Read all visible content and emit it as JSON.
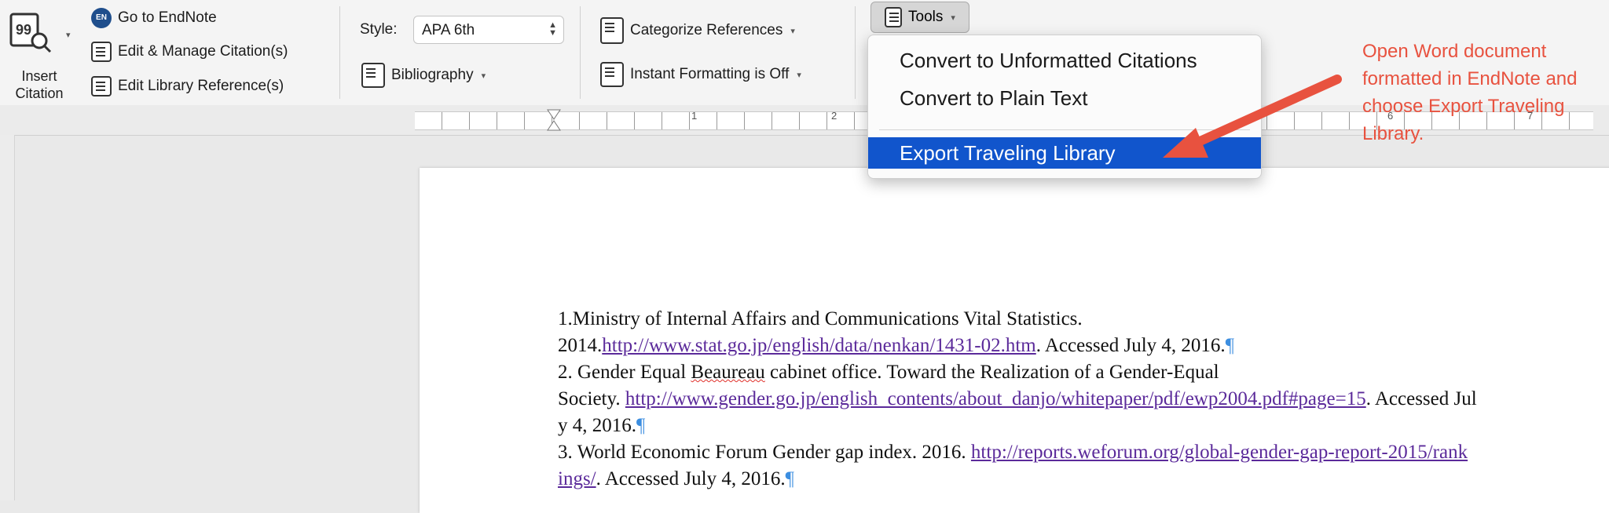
{
  "ribbon": {
    "insert_citation": "Insert\nCitation",
    "go_to_endnote": "Go to EndNote",
    "edit_manage": "Edit & Manage Citation(s)",
    "edit_library": "Edit Library Reference(s)",
    "style_label": "Style:",
    "style_value": "APA 6th",
    "bibliography": "Bibliography",
    "categorize": "Categorize References",
    "instant_formatting": "Instant Formatting is Off",
    "tools": "Tools"
  },
  "ruler_numbers": [
    "1",
    "2",
    "6",
    "7"
  ],
  "menu": {
    "items": [
      "Convert to Unformatted Citations",
      "Convert to Plain Text",
      "Export Traveling Library"
    ],
    "highlight_color": "#1155cc"
  },
  "annotation": {
    "text": "Open Word document formatted in EndNote and choose Export Traveling Library.",
    "color": "#e8523f"
  },
  "document": {
    "ref1_a": "1.",
    "ref1_b": "Ministry of Internal Affairs and Communications Vital Statistics.",
    "ref1_c": "2014.",
    "ref1_url": "http://www.stat.go.jp/english/data/nenkan/1431-02.htm",
    "ref1_d": ". Accessed July 4, 2016.",
    "ref2_a": "2.",
    "ref2_b": "Gender Equal",
    "ref2_c": "Beaureau",
    "ref2_d": "cabinet office. Toward the Realization of a Gender-Equal",
    "ref2_e": "Society.",
    "ref2_url": "http://www.gender.go.jp/english_contents/about_danjo/whitepaper/pdf/ewp2004.pdf#page=15",
    "ref2_f": ". Accessed July 4, 2016.",
    "ref3_a": "3.",
    "ref3_b": "World Economic Forum Gender gap index. 2016.",
    "ref3_url": "http://reports.weforum.org/global-gender-gap-report-2015/rankings/",
    "ref3_c": ". Accessed July 4, 2016.",
    "pilcrow": "¶"
  }
}
